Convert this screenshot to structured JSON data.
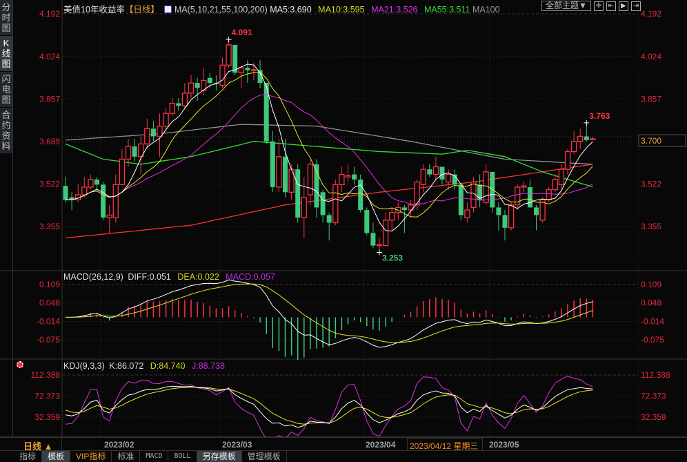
{
  "sidebar": {
    "tabs": [
      "分时图",
      "K线图",
      "闪电图",
      "合约资料"
    ],
    "active": 1
  },
  "header": {
    "title": "美债10年收益率",
    "period": "【日线】",
    "ma_label": "MA(5,10,21,55,100,200)",
    "ma5": "MA5:3.690",
    "ma10": "MA10:3.595",
    "ma21": "MA21:3.526",
    "ma55": "MA55:3.511",
    "ma100": "MA100",
    "theme_button": "全部主题▼"
  },
  "colors": {
    "up": "#ff3344",
    "down": "#3ec97e",
    "ma5": "#ffffff",
    "ma10": "#e8e820",
    "ma21": "#e030e0",
    "ma55": "#30e030",
    "ma100": "#909090",
    "ma200": "#ff3030",
    "axis": "#e8283c"
  },
  "price_axis": {
    "labels": [
      "4.192",
      "4.024",
      "3.857",
      "3.689",
      "3.522",
      "3.355"
    ],
    "current": "3.700",
    "high_label": "4.091",
    "low_label": "3.253",
    "recent_high_label": "3.763"
  },
  "macd": {
    "title": "MACD(26,12,9)",
    "diff": "DIFF:0.051",
    "dea": "DEA:0.022",
    "macd": "MACD:0.057",
    "labels": [
      "0.109",
      "0.048",
      "-0.014",
      "-0.075"
    ]
  },
  "kdj": {
    "title": "KDJ(9,3,3)",
    "k": "K:86.072",
    "d": "D:84.740",
    "j": "J:88.738",
    "labels": [
      "112.388",
      "72.373",
      "32.359"
    ]
  },
  "dates": {
    "period": "日线 ▲",
    "months": [
      "2023/02",
      "2023/03",
      "2023/04",
      "2023/05"
    ],
    "crosshair": "2023/04/12 星期三"
  },
  "toolbar": [
    "指标",
    "模板",
    "VIP指标",
    "标准",
    "MACD",
    "BOLL",
    "另存模板",
    "管理模板"
  ],
  "chart_data": {
    "type": "candlestick",
    "title": "美债10年收益率 日线",
    "ylim": [
      3.2,
      4.192
    ],
    "month_start_index": [
      6,
      25,
      48,
      68
    ],
    "candles_ohlc": [
      [
        3.515,
        3.55,
        3.45,
        3.46
      ],
      [
        3.47,
        3.49,
        3.42,
        3.46
      ],
      [
        3.46,
        3.52,
        3.45,
        3.48
      ],
      [
        3.48,
        3.55,
        3.47,
        3.51
      ],
      [
        3.51,
        3.56,
        3.5,
        3.54
      ],
      [
        3.54,
        3.55,
        3.49,
        3.52
      ],
      [
        3.52,
        3.53,
        3.38,
        3.39
      ],
      [
        3.39,
        3.44,
        3.33,
        3.4
      ],
      [
        3.39,
        3.56,
        3.37,
        3.52
      ],
      [
        3.52,
        3.66,
        3.52,
        3.62
      ],
      [
        3.62,
        3.7,
        3.59,
        3.67
      ],
      [
        3.67,
        3.7,
        3.61,
        3.63
      ],
      [
        3.63,
        3.71,
        3.56,
        3.68
      ],
      [
        3.68,
        3.78,
        3.66,
        3.74
      ],
      [
        3.74,
        3.77,
        3.69,
        3.71
      ],
      [
        3.71,
        3.8,
        3.63,
        3.75
      ],
      [
        3.75,
        3.82,
        3.73,
        3.8
      ],
      [
        3.8,
        3.86,
        3.79,
        3.84
      ],
      [
        3.84,
        3.86,
        3.81,
        3.83
      ],
      [
        3.83,
        3.92,
        3.82,
        3.88
      ],
      [
        3.88,
        3.95,
        3.86,
        3.92
      ],
      [
        3.92,
        3.94,
        3.85,
        3.9
      ],
      [
        3.89,
        3.98,
        3.87,
        3.93
      ],
      [
        3.94,
        3.96,
        3.9,
        3.92
      ],
      [
        3.92,
        3.95,
        3.89,
        3.915
      ],
      [
        3.91,
        4.02,
        3.9,
        3.99
      ],
      [
        3.99,
        4.091,
        3.98,
        4.07
      ],
      [
        4.07,
        4.07,
        3.95,
        3.96
      ],
      [
        3.96,
        3.99,
        3.9,
        3.98
      ],
      [
        3.98,
        4.01,
        3.92,
        3.97
      ],
      [
        3.97,
        4.0,
        3.93,
        3.972
      ],
      [
        3.97,
        4.01,
        3.9,
        3.92
      ],
      [
        3.92,
        3.92,
        3.68,
        3.69
      ],
      [
        3.69,
        3.73,
        3.49,
        3.51
      ],
      [
        3.51,
        3.7,
        3.49,
        3.63
      ],
      [
        3.63,
        3.7,
        3.47,
        3.49
      ],
      [
        3.49,
        3.6,
        3.46,
        3.58
      ],
      [
        3.58,
        3.6,
        3.37,
        3.39
      ],
      [
        3.39,
        3.55,
        3.31,
        3.47
      ],
      [
        3.48,
        3.62,
        3.44,
        3.6
      ],
      [
        3.6,
        3.62,
        3.39,
        3.43
      ],
      [
        3.49,
        3.5,
        3.37,
        3.4
      ],
      [
        3.4,
        3.41,
        3.3,
        3.37
      ],
      [
        3.37,
        3.54,
        3.36,
        3.52
      ],
      [
        3.52,
        3.59,
        3.49,
        3.56
      ],
      [
        3.55,
        3.6,
        3.53,
        3.555
      ],
      [
        3.56,
        3.59,
        3.52,
        3.54
      ],
      [
        3.54,
        3.56,
        3.41,
        3.42
      ],
      [
        3.42,
        3.43,
        3.32,
        3.33
      ],
      [
        3.33,
        3.37,
        3.27,
        3.28
      ],
      [
        3.28,
        3.31,
        3.253,
        3.285
      ],
      [
        3.28,
        3.41,
        3.28,
        3.38
      ],
      [
        3.38,
        3.43,
        3.34,
        3.41
      ],
      [
        3.41,
        3.45,
        3.38,
        3.43
      ],
      [
        3.43,
        3.44,
        3.33,
        3.42
      ],
      [
        3.42,
        3.46,
        3.39,
        3.44
      ],
      [
        3.44,
        3.54,
        3.42,
        3.53
      ],
      [
        3.52,
        3.6,
        3.49,
        3.58
      ],
      [
        3.58,
        3.6,
        3.55,
        3.56
      ],
      [
        3.56,
        3.63,
        3.54,
        3.59
      ],
      [
        3.59,
        3.59,
        3.52,
        3.54
      ],
      [
        3.53,
        3.58,
        3.5,
        3.56
      ],
      [
        3.56,
        3.58,
        3.5,
        3.52
      ],
      [
        3.52,
        3.52,
        3.38,
        3.4
      ],
      [
        3.39,
        3.45,
        3.37,
        3.42
      ],
      [
        3.43,
        3.55,
        3.41,
        3.53
      ],
      [
        3.52,
        3.56,
        3.43,
        3.46
      ],
      [
        3.45,
        3.6,
        3.44,
        3.57
      ],
      [
        3.57,
        3.57,
        3.41,
        3.43
      ],
      [
        3.43,
        3.45,
        3.34,
        3.4
      ],
      [
        3.4,
        3.42,
        3.3,
        3.35
      ],
      [
        3.35,
        3.45,
        3.34,
        3.44
      ],
      [
        3.44,
        3.52,
        3.42,
        3.51
      ],
      [
        3.51,
        3.53,
        3.49,
        3.515
      ],
      [
        3.51,
        3.54,
        3.43,
        3.43
      ],
      [
        3.43,
        3.44,
        3.34,
        3.4
      ],
      [
        3.38,
        3.47,
        3.37,
        3.46
      ],
      [
        3.46,
        3.51,
        3.45,
        3.5
      ],
      [
        3.5,
        3.56,
        3.49,
        3.54
      ],
      [
        3.52,
        3.6,
        3.5,
        3.58
      ],
      [
        3.58,
        3.66,
        3.56,
        3.65
      ],
      [
        3.65,
        3.73,
        3.64,
        3.69
      ],
      [
        3.69,
        3.74,
        3.66,
        3.71
      ],
      [
        3.71,
        3.763,
        3.69,
        3.695
      ],
      [
        3.7,
        3.71,
        3.698,
        3.7
      ]
    ],
    "ma55_points": [
      [
        0,
        3.68
      ],
      [
        6,
        3.62
      ],
      [
        12,
        3.6
      ],
      [
        20,
        3.63
      ],
      [
        30,
        3.69
      ],
      [
        40,
        3.67
      ],
      [
        50,
        3.65
      ],
      [
        60,
        3.64
      ],
      [
        64,
        3.655
      ],
      [
        70,
        3.63
      ],
      [
        76,
        3.57
      ],
      [
        84,
        3.511
      ]
    ],
    "ma100_points": [
      [
        0,
        3.695
      ],
      [
        15,
        3.72
      ],
      [
        28,
        3.757
      ],
      [
        40,
        3.75
      ],
      [
        55,
        3.69
      ],
      [
        70,
        3.62
      ],
      [
        84,
        3.6
      ]
    ],
    "ma200_points": [
      [
        0,
        3.31
      ],
      [
        20,
        3.36
      ],
      [
        35,
        3.44
      ],
      [
        50,
        3.49
      ],
      [
        65,
        3.53
      ],
      [
        84,
        3.6
      ]
    ]
  }
}
